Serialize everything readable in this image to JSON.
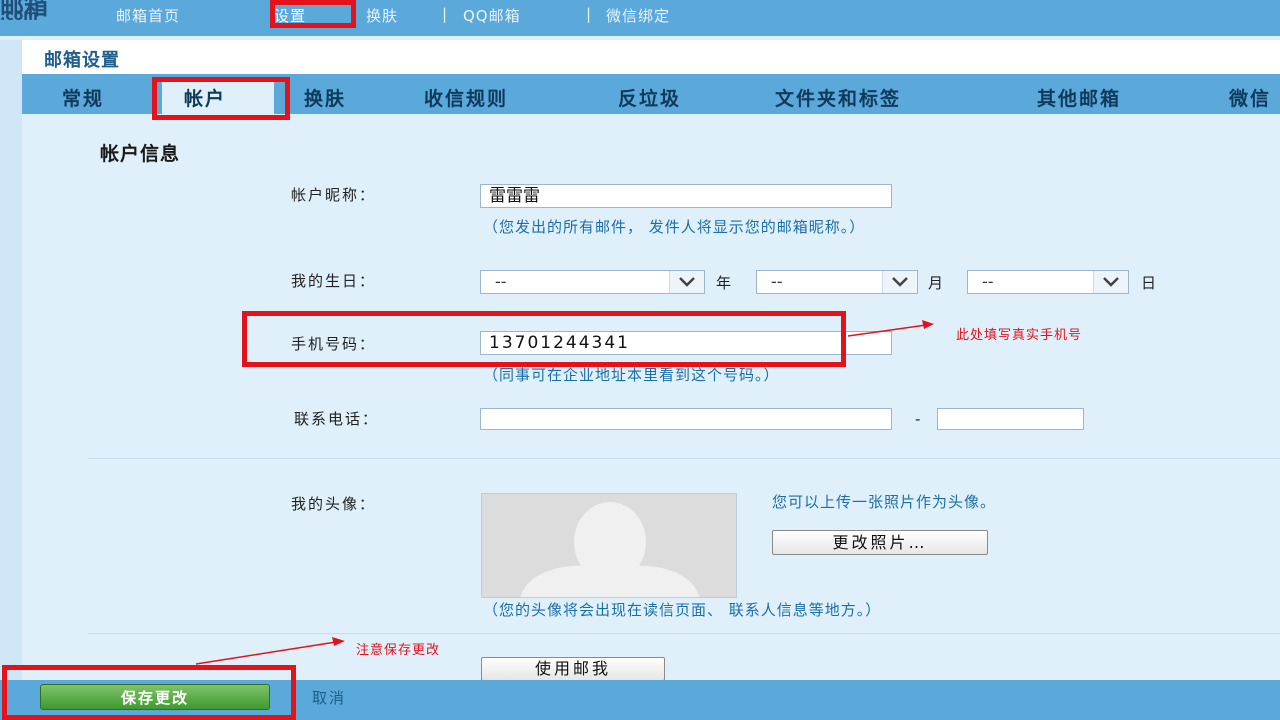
{
  "topbar": {
    "logo_top": "邮箱",
    "logo_domain": ".com",
    "nav": {
      "home": "邮箱首页",
      "settings": "设置",
      "skin": "换肤",
      "qqmail": "QQ邮箱",
      "wechat": "微信绑定",
      "sep": "|"
    }
  },
  "page": {
    "title": "邮箱设置",
    "tabs": [
      "常规",
      "帐户",
      "换肤",
      "收信规则",
      "反垃圾",
      "文件夹和标签",
      "其他邮箱",
      "微信"
    ],
    "active_tab": "帐户"
  },
  "account": {
    "section_title": "帐户信息",
    "nickname": {
      "label": "帐户昵称：",
      "value": "雷雷雷",
      "hint": "（您发出的所有邮件， 发件人将显示您的邮箱昵称。）"
    },
    "birthday": {
      "label": "我的生日：",
      "year_value": "--",
      "year_unit": "年",
      "month_value": "--",
      "month_unit": "月",
      "day_value": "--",
      "day_unit": "日"
    },
    "mobile": {
      "label": "手机号码：",
      "value": "13701244341",
      "hint": "（同事可在企业地址本里看到这个号码。）"
    },
    "phone": {
      "label": "联系电话：",
      "value_area": "",
      "dash": "-",
      "value_number": ""
    },
    "avatar": {
      "label": "我的头像：",
      "upload_hint": "您可以上传一张照片作为头像。",
      "change_button": "更改照片…",
      "display_hint": "（您的头像将会出现在读信页面、 联系人信息等地方。）",
      "use_mail_button": "使用邮我"
    }
  },
  "footer": {
    "save": "保存更改",
    "cancel": "取消"
  },
  "annotations": {
    "phone_note": "此处填写真实手机号",
    "save_note": "注意保存更改",
    "color": "#e3121b"
  }
}
